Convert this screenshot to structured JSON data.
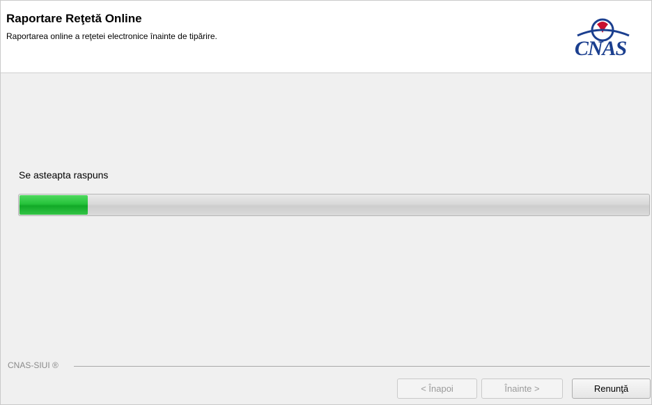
{
  "header": {
    "title": "Raportare Reţetă Online",
    "subtitle": "Raportarea online a reţetei electronice înainte de tipărire.",
    "logo_text": "CNAS"
  },
  "status": {
    "label": "Se asteapta raspuns",
    "progress_fraction": 0.11
  },
  "footer": {
    "brand": "CNAS-SIUI ®"
  },
  "buttons": {
    "back": "< Înapoi",
    "next": "Înainte >",
    "cancel": "Renunţă"
  },
  "colors": {
    "progress_fill": "#25c23a",
    "logo_blue": "#1b3f8f",
    "logo_red": "#c8102e"
  }
}
